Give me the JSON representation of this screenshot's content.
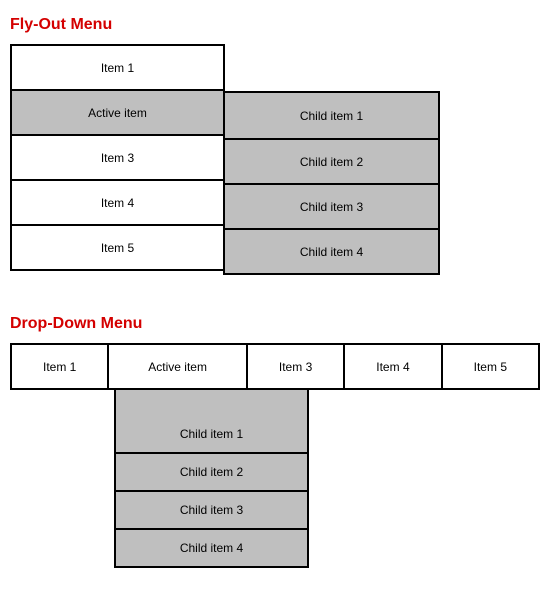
{
  "flyout": {
    "title": "Fly-Out Menu",
    "items": [
      {
        "label": "Item 1",
        "active": false
      },
      {
        "label": "Active item",
        "active": true
      },
      {
        "label": "Item 3",
        "active": false
      },
      {
        "label": "Item 4",
        "active": false
      },
      {
        "label": "Item 5",
        "active": false
      }
    ],
    "children": [
      {
        "label": "Child item 1"
      },
      {
        "label": "Child item 2"
      },
      {
        "label": "Child item 3"
      },
      {
        "label": "Child item 4"
      }
    ]
  },
  "dropdown": {
    "title": "Drop-Down Menu",
    "items": [
      {
        "label": "Item 1",
        "active": false
      },
      {
        "label": "Active item",
        "active": true
      },
      {
        "label": "Item 3",
        "active": false
      },
      {
        "label": "Item 4",
        "active": false
      },
      {
        "label": "Item 5",
        "active": false
      }
    ],
    "children": [
      {
        "label": "Child item 1"
      },
      {
        "label": "Child item 2"
      },
      {
        "label": "Child item 3"
      },
      {
        "label": "Child item 4"
      }
    ]
  },
  "colors": {
    "heading": "#d40000",
    "active_bg": "#bfbfbf",
    "border": "#000000"
  }
}
